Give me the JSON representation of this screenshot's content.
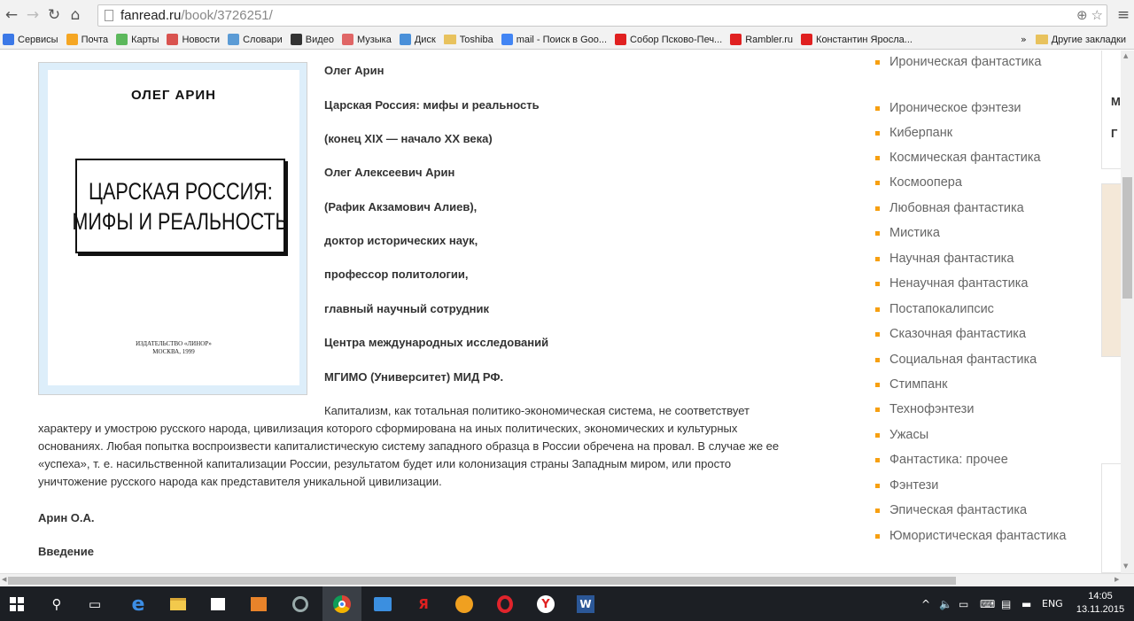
{
  "browser": {
    "url_host": "fanread.ru",
    "url_path": "/book/3726251/",
    "bookmarks": [
      {
        "label": "Сервисы",
        "icon": "apps-icon",
        "color": "#3b78e7"
      },
      {
        "label": "Почта",
        "icon": "mail-icon",
        "color": "#f5a623"
      },
      {
        "label": "Карты",
        "icon": "maps-icon",
        "color": "#5cb85c"
      },
      {
        "label": "Новости",
        "icon": "news-icon",
        "color": "#d9534f"
      },
      {
        "label": "Словари",
        "icon": "dictionary-icon",
        "color": "#5b9bd5"
      },
      {
        "label": "Видео",
        "icon": "video-icon",
        "color": "#333333"
      },
      {
        "label": "Музыка",
        "icon": "music-icon",
        "color": "#e06666"
      },
      {
        "label": "Диск",
        "icon": "disk-icon",
        "color": "#4a90d9"
      },
      {
        "label": "Toshiba",
        "icon": "folder-icon",
        "color": "#e8c25d"
      },
      {
        "label": "mail - Поиск в Goo...",
        "icon": "google-icon",
        "color": "#4285f4"
      },
      {
        "label": "Собор Псково-Печ...",
        "icon": "yandex-icon",
        "color": "#e02020"
      },
      {
        "label": "Rambler.ru",
        "icon": "yandex-icon",
        "color": "#e02020"
      },
      {
        "label": "Константин Яросла...",
        "icon": "yandex-icon",
        "color": "#e02020"
      }
    ],
    "more_label": "»",
    "other_bookmarks": "Другие закладки"
  },
  "book": {
    "cover_author": "ОЛЕГ АРИН",
    "cover_title_1": "ЦАРСКАЯ РОССИЯ:",
    "cover_title_2": "МИФЫ И РЕАЛЬНОСТЬ",
    "cover_pub_1": "ИЗДАТЕЛЬСТВО «ЛИНОР»",
    "cover_pub_2": "МОСКВА, 1999",
    "meta": [
      "Олег Арин",
      "Царская Россия: мифы и реальность",
      "(конец XIX — начало XX века)",
      "Олег Алексеевич Арин",
      "(Рафик Акзамович Алиев),",
      "доктор исторических наук,",
      "профессор политологии,",
      "главный научный сотрудник",
      "Центра международных исследований",
      "МГИМО (Университет) МИД РФ."
    ],
    "paragraph": "Капитализм, как тотальная политико-экономическая система, не соответствует характеру и умострою русского народа, цивилизация которого сформирована на иных политических, экономических и культурных основаниях. Любая попытка воспроизвести капиталистическую систему западного образца в России обречена на провал. В случае же ее «успеха», т. е. насильственной капитализации России, результатом будет или колонизация страны Западным миром, или просто уничтожение русского народа как представителя уникальной цивилизации.",
    "signature": "Арин О.А.",
    "section": "Введение"
  },
  "genres": [
    "Ироническая фантастика",
    "Ироническое фэнтези",
    "Киберпанк",
    "Космическая фантастика",
    "Космоопера",
    "Любовная фантастика",
    "Мистика",
    "Научная фантастика",
    "Ненаучная фантастика",
    "Постапокалипсис",
    "Сказочная фантастика",
    "Социальная фантастика",
    "Стимпанк",
    "Технофэнтези",
    "Ужасы",
    "Фантастика: прочее",
    "Фэнтези",
    "Эпическая фантастика",
    "Юмористическая фантастика"
  ],
  "side": {
    "letter_1": "М",
    "letter_2": "Г"
  },
  "taskbar": {
    "lang": "ENG",
    "time": "14:05",
    "date": "13.11.2015"
  },
  "colors": {
    "genre_bullet": "#f7a011",
    "taskbar": "#1c1f24"
  }
}
